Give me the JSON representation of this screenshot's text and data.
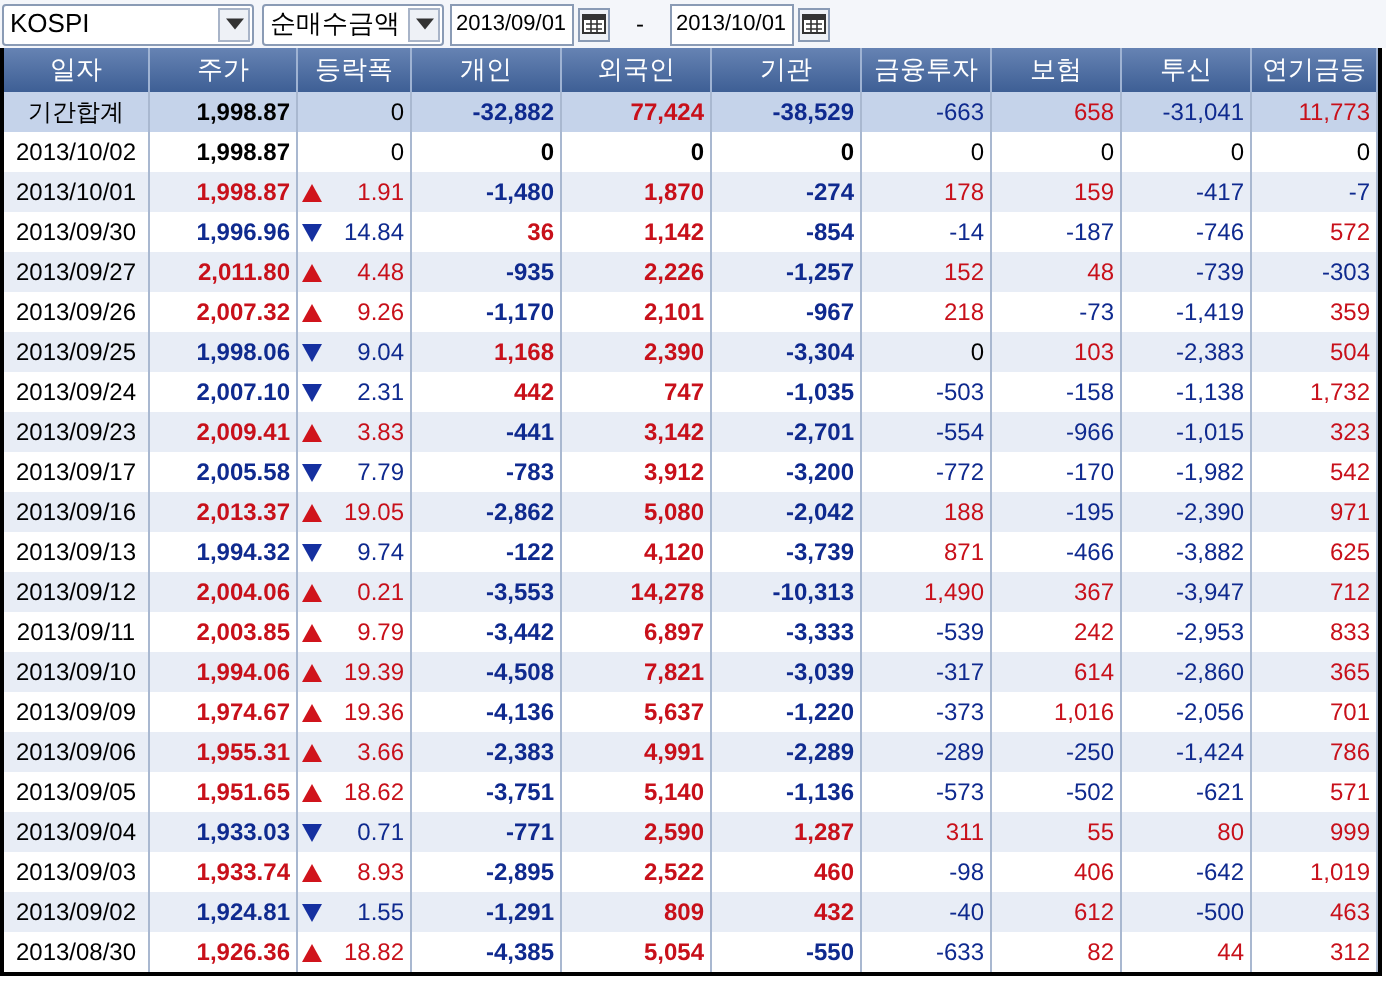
{
  "toolbar": {
    "market": "KOSPI",
    "measure": "순매수금액",
    "start_date": "2013/09/01",
    "separator": "-",
    "end_date": "2013/10/01"
  },
  "table": {
    "columns": [
      "일자",
      "주가",
      "등락폭",
      "개인",
      "외국인",
      "기관",
      "금융투자",
      "보험",
      "투신",
      "연기금등"
    ],
    "rows": [
      {
        "kind": "summary",
        "cells": [
          "기간합계",
          "1,998.87",
          "0",
          "-32,882",
          "77,424",
          "-38,529",
          "-663",
          "658",
          "-31,041",
          "11,773"
        ]
      },
      {
        "kind": "flat",
        "cells": [
          "2013/10/02",
          "1,998.87",
          "0",
          "0",
          "0",
          "0",
          "0",
          "0",
          "0",
          "0"
        ]
      },
      {
        "kind": "up",
        "cells": [
          "2013/10/01",
          "1,998.87",
          "1.91",
          "-1,480",
          "1,870",
          "-274",
          "178",
          "159",
          "-417",
          "-7"
        ]
      },
      {
        "kind": "down",
        "cells": [
          "2013/09/30",
          "1,996.96",
          "14.84",
          "36",
          "1,142",
          "-854",
          "-14",
          "-187",
          "-746",
          "572"
        ]
      },
      {
        "kind": "up",
        "cells": [
          "2013/09/27",
          "2,011.80",
          "4.48",
          "-935",
          "2,226",
          "-1,257",
          "152",
          "48",
          "-739",
          "-303"
        ]
      },
      {
        "kind": "up",
        "cells": [
          "2013/09/26",
          "2,007.32",
          "9.26",
          "-1,170",
          "2,101",
          "-967",
          "218",
          "-73",
          "-1,419",
          "359"
        ]
      },
      {
        "kind": "down",
        "cells": [
          "2013/09/25",
          "1,998.06",
          "9.04",
          "1,168",
          "2,390",
          "-3,304",
          "0",
          "103",
          "-2,383",
          "504"
        ]
      },
      {
        "kind": "down",
        "cells": [
          "2013/09/24",
          "2,007.10",
          "2.31",
          "442",
          "747",
          "-1,035",
          "-503",
          "-158",
          "-1,138",
          "1,732"
        ]
      },
      {
        "kind": "up",
        "cells": [
          "2013/09/23",
          "2,009.41",
          "3.83",
          "-441",
          "3,142",
          "-2,701",
          "-554",
          "-966",
          "-1,015",
          "323"
        ]
      },
      {
        "kind": "down",
        "cells": [
          "2013/09/17",
          "2,005.58",
          "7.79",
          "-783",
          "3,912",
          "-3,200",
          "-772",
          "-170",
          "-1,982",
          "542"
        ]
      },
      {
        "kind": "up",
        "cells": [
          "2013/09/16",
          "2,013.37",
          "19.05",
          "-2,862",
          "5,080",
          "-2,042",
          "188",
          "-195",
          "-2,390",
          "971"
        ]
      },
      {
        "kind": "down",
        "cells": [
          "2013/09/13",
          "1,994.32",
          "9.74",
          "-122",
          "4,120",
          "-3,739",
          "871",
          "-466",
          "-3,882",
          "625"
        ]
      },
      {
        "kind": "up",
        "cells": [
          "2013/09/12",
          "2,004.06",
          "0.21",
          "-3,553",
          "14,278",
          "-10,313",
          "1,490",
          "367",
          "-3,947",
          "712"
        ]
      },
      {
        "kind": "up",
        "cells": [
          "2013/09/11",
          "2,003.85",
          "9.79",
          "-3,442",
          "6,897",
          "-3,333",
          "-539",
          "242",
          "-2,953",
          "833"
        ]
      },
      {
        "kind": "up",
        "cells": [
          "2013/09/10",
          "1,994.06",
          "19.39",
          "-4,508",
          "7,821",
          "-3,039",
          "-317",
          "614",
          "-2,860",
          "365"
        ]
      },
      {
        "kind": "up",
        "cells": [
          "2013/09/09",
          "1,974.67",
          "19.36",
          "-4,136",
          "5,637",
          "-1,220",
          "-373",
          "1,016",
          "-2,056",
          "701"
        ]
      },
      {
        "kind": "up",
        "cells": [
          "2013/09/06",
          "1,955.31",
          "3.66",
          "-2,383",
          "4,991",
          "-2,289",
          "-289",
          "-250",
          "-1,424",
          "786"
        ]
      },
      {
        "kind": "up",
        "cells": [
          "2013/09/05",
          "1,951.65",
          "18.62",
          "-3,751",
          "5,140",
          "-1,136",
          "-573",
          "-502",
          "-621",
          "571"
        ]
      },
      {
        "kind": "down",
        "cells": [
          "2013/09/04",
          "1,933.03",
          "0.71",
          "-771",
          "2,590",
          "1,287",
          "311",
          "55",
          "80",
          "999"
        ]
      },
      {
        "kind": "up",
        "cells": [
          "2013/09/03",
          "1,933.74",
          "8.93",
          "-2,895",
          "2,522",
          "460",
          "-98",
          "406",
          "-642",
          "1,019"
        ]
      },
      {
        "kind": "down",
        "cells": [
          "2013/09/02",
          "1,924.81",
          "1.55",
          "-1,291",
          "809",
          "432",
          "-40",
          "612",
          "-500",
          "463"
        ]
      },
      {
        "kind": "up",
        "cells": [
          "2013/08/30",
          "1,926.36",
          "18.82",
          "-4,385",
          "5,054",
          "-550",
          "-633",
          "82",
          "44",
          "312"
        ]
      }
    ]
  }
}
